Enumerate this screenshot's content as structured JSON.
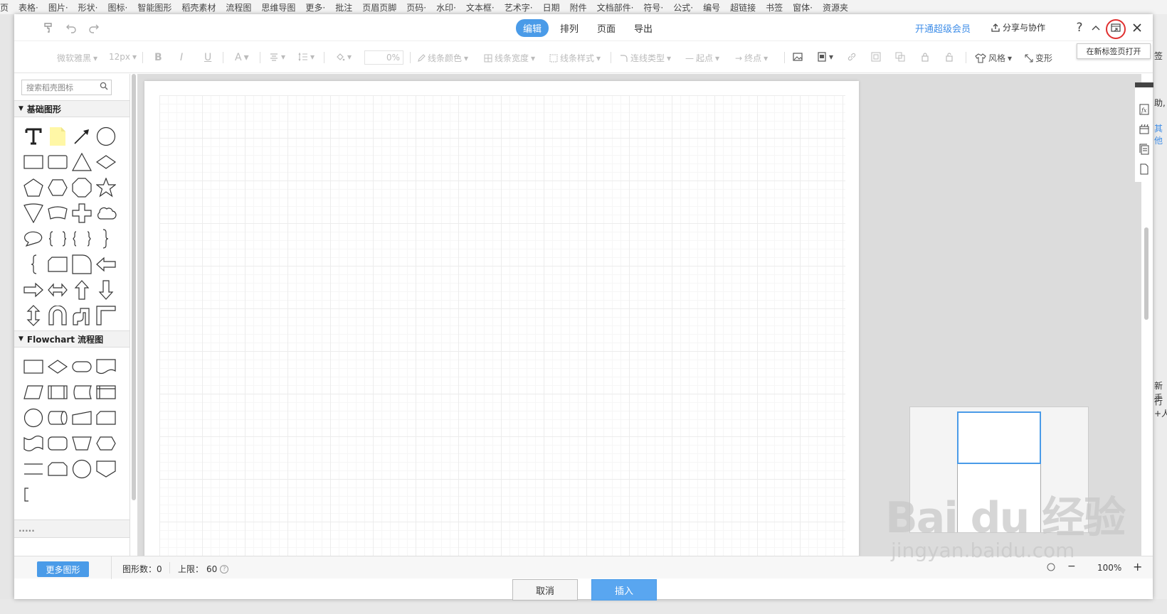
{
  "ribbon": [
    "页",
    "表格·",
    "图片·",
    "形状·",
    "图标·",
    "智能图形",
    "稻壳素材",
    "流程图",
    "思维导图",
    "更多·",
    "批注",
    "页眉页脚",
    "页码·",
    "水印·",
    "文本框·",
    "艺术字·",
    "日期",
    "附件",
    "文档部件·",
    "符号·",
    "公式·",
    "编号",
    "超链接",
    "书签",
    "窗体·",
    "资源夹"
  ],
  "side_text": [
    "签",
    "助,",
    "其他",
    "新手",
    "行+人"
  ],
  "tabs": [
    {
      "label": "编辑",
      "active": true
    },
    {
      "label": "排列",
      "active": false
    },
    {
      "label": "页面",
      "active": false
    },
    {
      "label": "导出",
      "active": false
    }
  ],
  "header": {
    "vip": "开通超级会员",
    "share": "分享与协作",
    "help": "?",
    "tooltip": "在新标签页打开"
  },
  "toolbar": {
    "font": "微软雅黑",
    "size": "12px",
    "bold": "B",
    "italic": "I",
    "underline": "U",
    "fontcolor": "A",
    "opacity": "0%",
    "line_color": "线条颜色",
    "line_width": "线条宽度",
    "line_style": "线条样式",
    "connector": "连线类型",
    "start": "起点",
    "end": "终点",
    "style": "风格",
    "style2": "变形"
  },
  "panel": {
    "search_placeholder": "搜索稻壳图标",
    "section_basic": "基础图形",
    "section_flow": "Flowchart 流程图",
    "section_next": "....."
  },
  "status": {
    "more_shapes": "更多图形",
    "shape_count_label": "图形数：",
    "shape_count": "0",
    "limit_label": "上限：",
    "limit": "60",
    "zoom": "100%",
    "zoom_in": "+",
    "zoom_out": "−"
  },
  "footer": {
    "cancel": "取消",
    "insert": "插入"
  },
  "watermark": {
    "brand": "Bai du 经验",
    "url": "jingyan.baidu.com"
  },
  "colors": {
    "accent": "#4a9be8",
    "highlight": "#e03030"
  }
}
